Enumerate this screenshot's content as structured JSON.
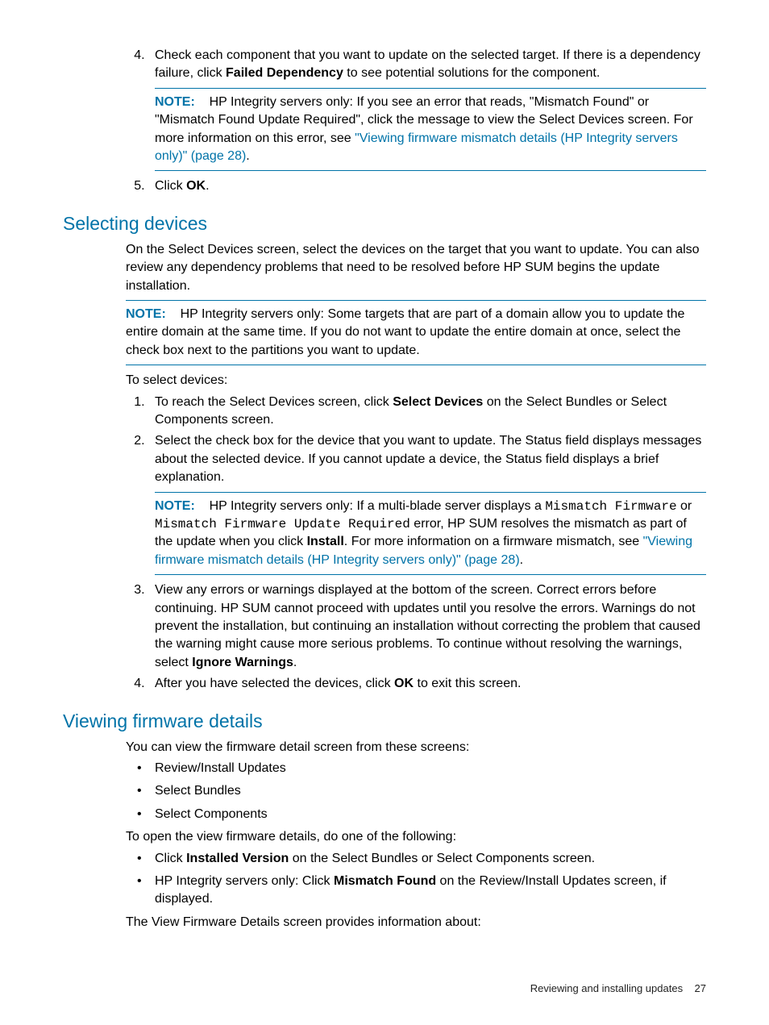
{
  "step4": {
    "num": "4.",
    "t1": "Check each component that you want to update on the selected target. If there is a dependency failure, click ",
    "b1": "Failed Dependency",
    "t2": " to see potential solutions for the component.",
    "note_label": "NOTE:",
    "note_t1": "HP Integrity servers only: If you see an error that reads, \"Mismatch Found\" or \"Mismatch Found Update Required\", click the message to view the Select Devices screen. For more information on this error, see ",
    "note_link": "\"Viewing firmware mismatch details (HP Integrity servers only)\" (page 28)",
    "note_t2": "."
  },
  "step5": {
    "num": "5.",
    "t1": "Click ",
    "b1": "OK",
    "t2": "."
  },
  "sec1": {
    "heading": "Selecting devices",
    "p1": "On the Select Devices screen, select the devices on the target that you want to update. You can also review any dependency problems that need to be resolved before HP SUM begins the update installation.",
    "note_label": "NOTE:",
    "note_text": "HP Integrity servers only: Some targets that are part of a domain allow you to update the entire domain at the same time. If you do not want to update the entire domain at once, select the check box next to the partitions you want to update.",
    "p2": "To select devices:",
    "li1": {
      "t1": "To reach the Select Devices screen, click ",
      "b1": "Select Devices",
      "t2": " on the Select Bundles or Select Components screen."
    },
    "li2": {
      "t1": "Select the check box for the device that you want to update. The Status field displays messages about the selected device. If you cannot update a device, the Status field displays a brief explanation.",
      "note_label": "NOTE:",
      "note_t1": "HP Integrity servers only: If a multi-blade server displays a ",
      "mono1": "Mismatch Firmware",
      "note_t2": " or ",
      "mono2": "Mismatch Firmware Update Required",
      "note_t3": " error, HP SUM resolves the mismatch as part of the update when you click ",
      "b1": "Install",
      "note_t4": ". For more information on a firmware mismatch, see ",
      "link": "\"Viewing firmware mismatch details (HP Integrity servers only)\" (page 28)",
      "note_t5": "."
    },
    "li3": {
      "t1": "View any errors or warnings displayed at the bottom of the screen. Correct errors before continuing. HP SUM cannot proceed with updates until you resolve the errors. Warnings do not prevent the installation, but continuing an installation without correcting the problem that caused the warning might cause more serious problems. To continue without resolving the warnings, select ",
      "b1": "Ignore Warnings",
      "t2": "."
    },
    "li4": {
      "t1": "After you have selected the devices, click ",
      "b1": "OK",
      "t2": " to exit this screen."
    }
  },
  "sec2": {
    "heading": "Viewing firmware details",
    "p1": "You can view the firmware detail screen from these screens:",
    "bul1": "Review/Install Updates",
    "bul2": "Select Bundles",
    "bul3": "Select Components",
    "p2": "To open the view firmware details, do one of the following:",
    "b2_li1": {
      "t1": "Click ",
      "b1": "Installed Version",
      "t2": " on the Select Bundles or Select Components screen."
    },
    "b2_li2": {
      "t1": "HP Integrity servers only: Click ",
      "b1": "Mismatch Found",
      "t2": " on the Review/Install Updates screen, if displayed."
    },
    "p3": "The View Firmware Details screen provides information about:"
  },
  "footer": {
    "title": "Reviewing and installing updates",
    "page": "27"
  }
}
